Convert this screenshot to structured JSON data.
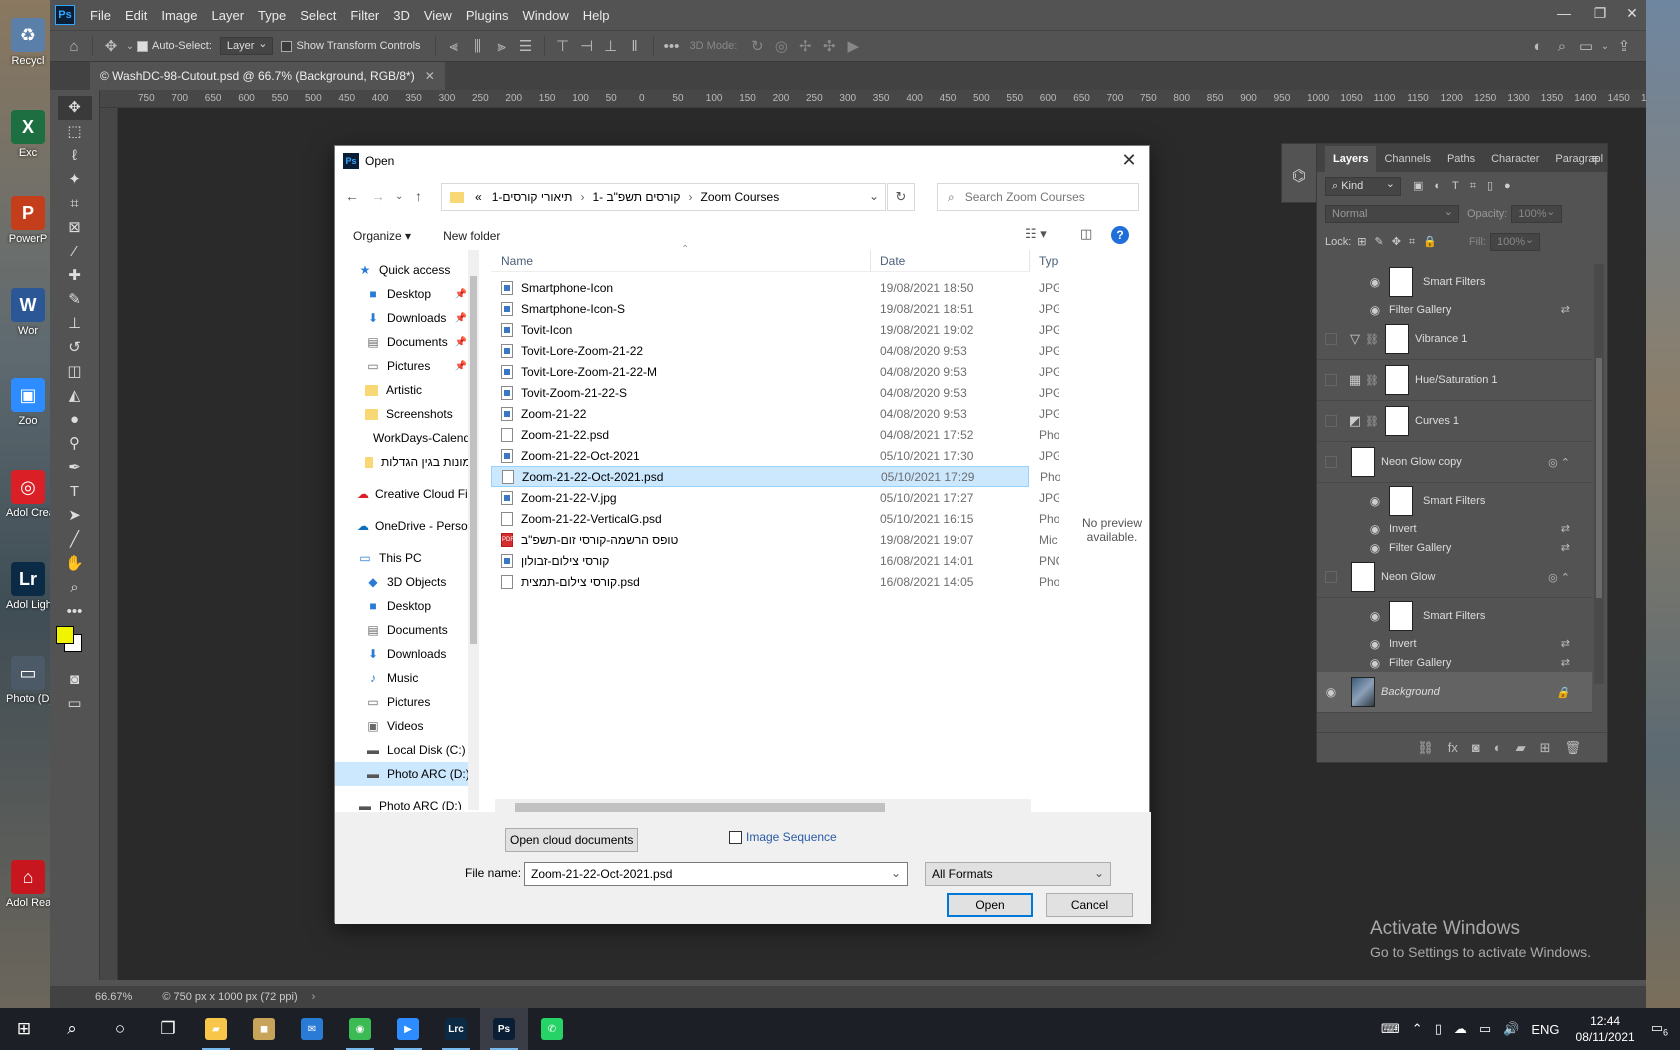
{
  "desktop": {
    "icons": [
      {
        "label": "Recycl",
        "letter": "♻",
        "color": "#5a7fa8"
      },
      {
        "label": "Exc",
        "letter": "X",
        "color": "#1d6f42"
      },
      {
        "label": "PowerP",
        "letter": "P",
        "color": "#c43e1c"
      },
      {
        "label": "Wor",
        "letter": "W",
        "color": "#2b5797"
      },
      {
        "label": "Zoo",
        "letter": "▣",
        "color": "#2d8cff"
      },
      {
        "label": "Adol Creat",
        "letter": "◎",
        "color": "#da1f26"
      },
      {
        "label": "Adol Lightr",
        "letter": "Lr",
        "color": "#0b2a45"
      },
      {
        "label": "Photo (D) - Sh",
        "letter": "▭",
        "color": "#4b5a66"
      },
      {
        "label": "Adol Reade",
        "letter": "⌂",
        "color": "#c8161e"
      }
    ]
  },
  "photoshop": {
    "logo": "Ps",
    "menu": [
      "File",
      "Edit",
      "Image",
      "Layer",
      "Type",
      "Select",
      "Filter",
      "3D",
      "View",
      "Plugins",
      "Window",
      "Help"
    ],
    "options": {
      "auto_select_label": "Auto-Select:",
      "auto_select_value": "Layer",
      "transform_label": "Show Transform Controls",
      "mode_3d": "3D Mode:"
    },
    "doc_tab": "© WashDC-98-Cutout.psd @ 66.7% (Background, RGB/8*)",
    "ruler": [
      "750",
      "700",
      "650",
      "600",
      "550",
      "500",
      "450",
      "400",
      "350",
      "300",
      "250",
      "200",
      "150",
      "100",
      "50",
      "0",
      "50",
      "100",
      "150",
      "200",
      "250",
      "300",
      "350",
      "400",
      "450",
      "500",
      "550",
      "600",
      "650",
      "700",
      "750",
      "800",
      "850",
      "900",
      "950",
      "1000",
      "1050",
      "1100",
      "1150",
      "1200",
      "1250",
      "1300",
      "1350",
      "1400",
      "1450",
      "150"
    ],
    "status": {
      "zoom": "66.67%",
      "info": "© 750 px x 1000 px (72 ppi)"
    }
  },
  "layers_panel": {
    "tabs": [
      "Layers",
      "Channels",
      "Paths",
      "Character",
      "Paragrapl"
    ],
    "kind": "Kind",
    "blend": "Normal",
    "opacity_label": "Opacity:",
    "opacity_value": "100%",
    "lock_label": "Lock:",
    "fill_label": "Fill:",
    "fill_value": "100%",
    "layers": [
      {
        "type": "sub-thumb",
        "name": "Smart Filters"
      },
      {
        "type": "sub",
        "name": "Filter Gallery"
      },
      {
        "type": "adj",
        "icon": "▽",
        "name": "Vibrance 1"
      },
      {
        "type": "adj",
        "icon": "▦",
        "name": "Hue/Saturation 1"
      },
      {
        "type": "adj",
        "icon": "◩",
        "name": "Curves 1"
      },
      {
        "type": "smart",
        "name": "Neon Glow copy"
      },
      {
        "type": "sub-thumb",
        "name": "Smart Filters"
      },
      {
        "type": "sub",
        "name": "Invert"
      },
      {
        "type": "sub",
        "name": "Filter Gallery"
      },
      {
        "type": "smart",
        "name": "Neon Glow"
      },
      {
        "type": "sub-thumb",
        "name": "Smart Filters"
      },
      {
        "type": "sub",
        "name": "Invert"
      },
      {
        "type": "sub",
        "name": "Filter Gallery"
      },
      {
        "type": "bg",
        "name": "Background"
      }
    ]
  },
  "watermark": {
    "line1": "Activate Windows",
    "line2": "Go to Settings to activate Windows."
  },
  "dialog": {
    "title": "Open",
    "breadcrumb": [
      "«",
      "תיאורי קורסים-1",
      "קורסים תשפ\"ב -1",
      "Zoom Courses"
    ],
    "search_placeholder": "Search Zoom Courses",
    "organize": "Organize ▾",
    "new_folder": "New folder",
    "nav": [
      {
        "label": "Quick access",
        "icon": "★",
        "top": true,
        "color": "#2a7bd6"
      },
      {
        "label": "Desktop",
        "icon": "■",
        "pin": true,
        "color": "#2a7bd6"
      },
      {
        "label": "Downloads",
        "icon": "⬇",
        "pin": true,
        "color": "#2a7bd6"
      },
      {
        "label": "Documents",
        "icon": "▤",
        "pin": true,
        "color": "#6a6a6a"
      },
      {
        "label": "Pictures",
        "icon": "▭",
        "pin": true,
        "color": "#6a6a6a"
      },
      {
        "label": "Artistic",
        "folder": true
      },
      {
        "label": "Screenshots",
        "folder": true
      },
      {
        "label": "WorkDays-Calendar",
        "folder": true
      },
      {
        "label": "תמונות בגין הגדלות",
        "folder": true
      },
      {
        "label": "Creative Cloud Files",
        "icon": "☁",
        "top": true,
        "color": "#da1f26"
      },
      {
        "label": "OneDrive - Personal",
        "icon": "☁",
        "top": true,
        "color": "#0f6cbd"
      },
      {
        "label": "This PC",
        "icon": "▭",
        "top": true,
        "color": "#2a7bd6"
      },
      {
        "label": "3D Objects",
        "icon": "◆",
        "color": "#2a7bd6"
      },
      {
        "label": "Desktop",
        "icon": "■",
        "color": "#2a7bd6"
      },
      {
        "label": "Documents",
        "icon": "▤",
        "color": "#6a6a6a"
      },
      {
        "label": "Downloads",
        "icon": "⬇",
        "color": "#2a7bd6"
      },
      {
        "label": "Music",
        "icon": "♪",
        "color": "#2a7bd6"
      },
      {
        "label": "Pictures",
        "icon": "▭",
        "color": "#6a6a6a"
      },
      {
        "label": "Videos",
        "icon": "▣",
        "color": "#6a6a6a"
      },
      {
        "label": "Local Disk (C:)",
        "icon": "▬",
        "color": "#555"
      },
      {
        "label": "Photo ARC (D:)",
        "icon": "▬",
        "selected": true,
        "color": "#555"
      },
      {
        "label": "Photo ARC (D:)",
        "icon": "▬",
        "top": true,
        "color": "#555"
      }
    ],
    "columns": {
      "name": "Name",
      "date": "Date",
      "type": "Type"
    },
    "files": [
      {
        "name": "Smartphone-Icon",
        "date": "19/08/2021 18:50",
        "type": "JPG",
        "icon": "jpg"
      },
      {
        "name": "Smartphone-Icon-S",
        "date": "19/08/2021 18:51",
        "type": "JPG",
        "icon": "jpg"
      },
      {
        "name": "Tovit-Icon",
        "date": "19/08/2021 19:02",
        "type": "JPG",
        "icon": "jpg"
      },
      {
        "name": "Tovit-Lore-Zoom-21-22",
        "date": "04/08/2020 9:53",
        "type": "JPG",
        "icon": "jpg"
      },
      {
        "name": "Tovit-Lore-Zoom-21-22-M",
        "date": "04/08/2020 9:53",
        "type": "JPG",
        "icon": "jpg"
      },
      {
        "name": "Tovit-Zoom-21-22-S",
        "date": "04/08/2020 9:53",
        "type": "JPG",
        "icon": "jpg"
      },
      {
        "name": "Zoom-21-22",
        "date": "04/08/2020 9:53",
        "type": "JPG",
        "icon": "jpg"
      },
      {
        "name": "Zoom-21-22.psd",
        "date": "04/08/2021 17:52",
        "type": "Pho",
        "icon": "doc"
      },
      {
        "name": "Zoom-21-22-Oct-2021",
        "date": "05/10/2021 17:30",
        "type": "JPG",
        "icon": "jpg"
      },
      {
        "name": "Zoom-21-22-Oct-2021.psd",
        "date": "05/10/2021 17:29",
        "type": "Pho",
        "icon": "doc",
        "selected": true
      },
      {
        "name": "Zoom-21-22-V.jpg",
        "date": "05/10/2021 17:27",
        "type": "JPG",
        "icon": "jpg"
      },
      {
        "name": "Zoom-21-22-VerticalG.psd",
        "date": "05/10/2021 16:15",
        "type": "Pho",
        "icon": "doc"
      },
      {
        "name": "טופס הרשמה-קורסי זום-תשפ\"ב",
        "date": "19/08/2021 19:07",
        "type": "Mic",
        "icon": "pdf"
      },
      {
        "name": "קורסי צילום-זבולון",
        "date": "16/08/2021 14:01",
        "type": "PNG",
        "icon": "jpg"
      },
      {
        "name": "קורסי צילום-תמצית.psd",
        "date": "16/08/2021 14:05",
        "type": "Pho",
        "icon": "doc"
      }
    ],
    "no_preview": "No preview available.",
    "cloud_button": "Open cloud documents",
    "image_sequence": "Image Sequence",
    "file_name_label": "File name:",
    "file_name_value": "Zoom-21-22-Oct-2021.psd",
    "format_value": "All Formats",
    "open_button": "Open",
    "cancel_button": "Cancel"
  },
  "taskbar": {
    "apps": [
      {
        "name": "start",
        "glyph": "⊞"
      },
      {
        "name": "search",
        "glyph": "⌕"
      },
      {
        "name": "cortana",
        "glyph": "○"
      },
      {
        "name": "task-view",
        "glyph": "❐"
      },
      {
        "name": "file-explorer",
        "glyph": "▰",
        "color": "#f8c74a",
        "running": true
      },
      {
        "name": "store",
        "glyph": "◼",
        "color": "#c8a45a"
      },
      {
        "name": "mail",
        "glyph": "✉",
        "color": "#2a7bd6"
      },
      {
        "name": "chrome",
        "glyph": "◉",
        "color": "#3cba54",
        "running": true
      },
      {
        "name": "zoom",
        "glyph": "▶",
        "color": "#2d8cff",
        "running": true
      },
      {
        "name": "lightroom-classic",
        "glyph": "Lrc",
        "color": "#0b2a45",
        "running": true
      },
      {
        "name": "photoshop",
        "glyph": "Ps",
        "color": "#0a1e36",
        "running": true,
        "active": true
      },
      {
        "name": "whatsapp",
        "glyph": "✆",
        "color": "#25d366"
      }
    ],
    "lang": "ENG",
    "time": "12:44",
    "date": "08/11/2021",
    "notifications": "6"
  }
}
